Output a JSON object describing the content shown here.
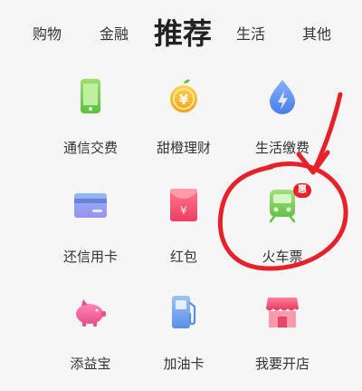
{
  "tabs": [
    {
      "label": "购物"
    },
    {
      "label": "金融"
    },
    {
      "label": "推荐",
      "active": true
    },
    {
      "label": "生活"
    },
    {
      "label": "其他"
    }
  ],
  "grid": {
    "items": [
      {
        "label": "通信交费",
        "icon": "phone-icon"
      },
      {
        "label": "甜橙理财",
        "icon": "coin-icon"
      },
      {
        "label": "生活缴费",
        "icon": "water-drop-bolt-icon"
      },
      {
        "label": "还信用卡",
        "icon": "credit-card-icon"
      },
      {
        "label": "红包",
        "icon": "red-envelope-icon"
      },
      {
        "label": "火车票",
        "icon": "train-icon",
        "badge": "惠"
      },
      {
        "label": "添益宝",
        "icon": "piggy-bank-icon"
      },
      {
        "label": "加油卡",
        "icon": "gas-pump-icon"
      },
      {
        "label": "我要开店",
        "icon": "storefront-icon"
      }
    ]
  },
  "colors": {
    "accent_red": "#e8202a",
    "phone_green": "#7fd35a",
    "coin_orange": "#f4a31a",
    "drop_blue": "#5b8ff0",
    "card_blue": "#6aa3ea",
    "envelope_pink": "#f0506e",
    "train_green": "#7ccf58",
    "piggy_pink": "#f0659a",
    "pump_blue": "#6aa3ea",
    "store_pink": "#f15a7a"
  }
}
